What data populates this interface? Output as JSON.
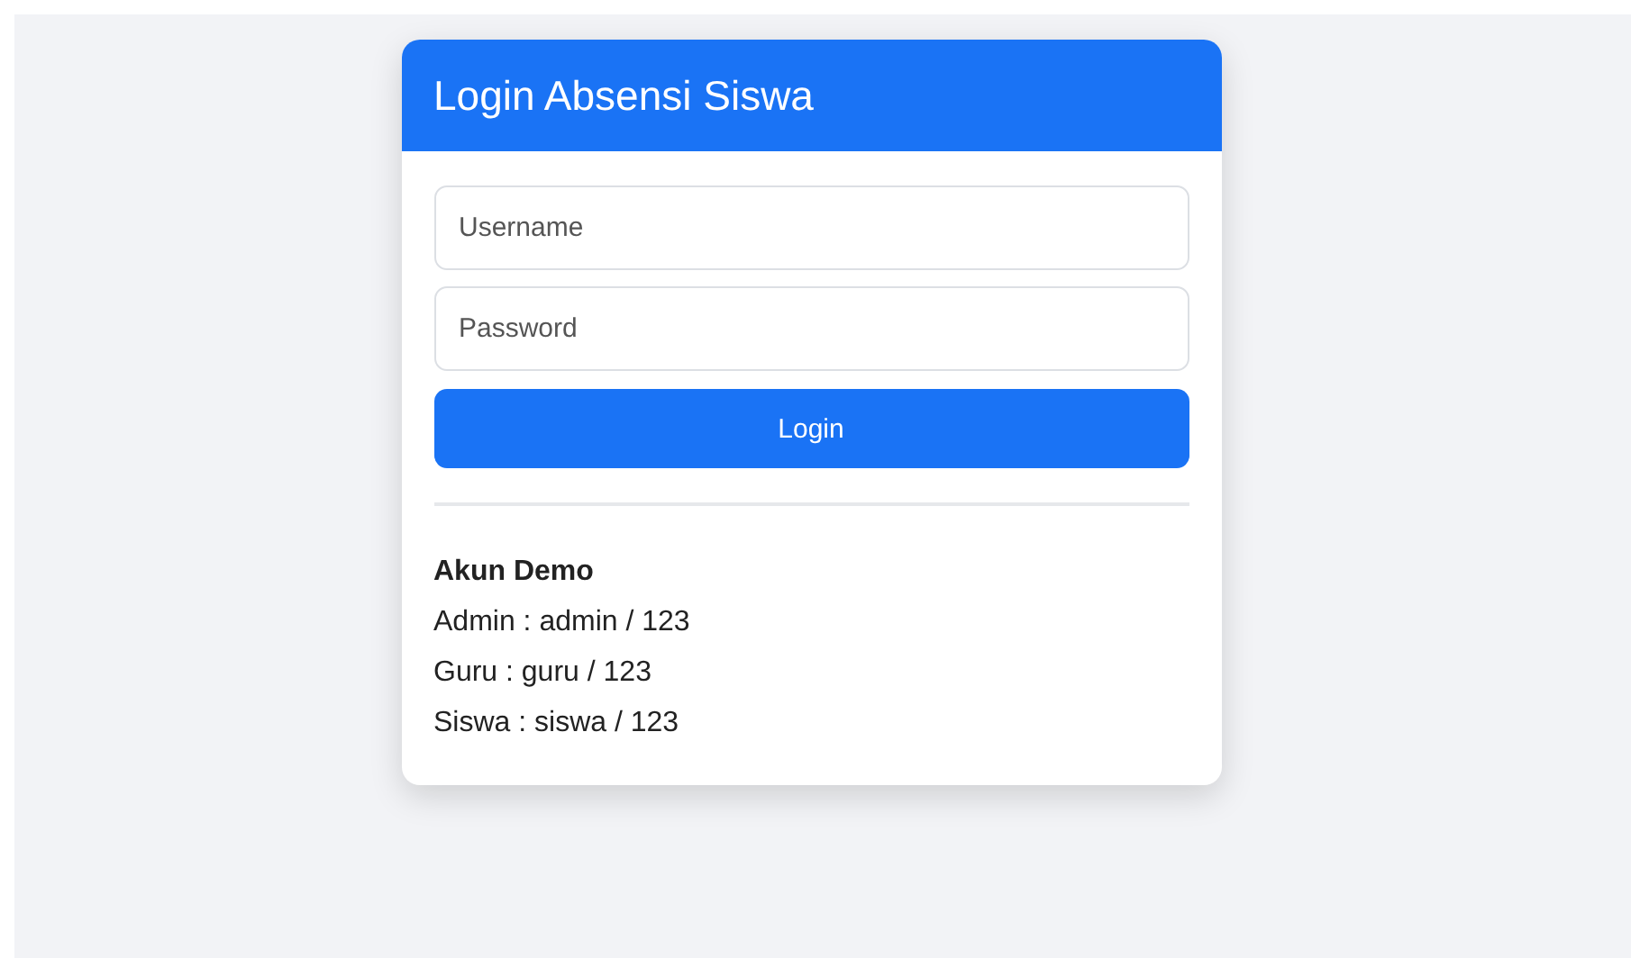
{
  "card": {
    "title": "Login Absensi Siswa"
  },
  "fields": [
    {
      "placeholder": "Username"
    },
    {
      "placeholder": "Password"
    }
  ],
  "button": "Login",
  "demo": {
    "heading": "Akun Demo",
    "lines": [
      "Admin : admin / 123",
      "Guru : guru / 123",
      "Siswa : siswa / 123"
    ]
  }
}
